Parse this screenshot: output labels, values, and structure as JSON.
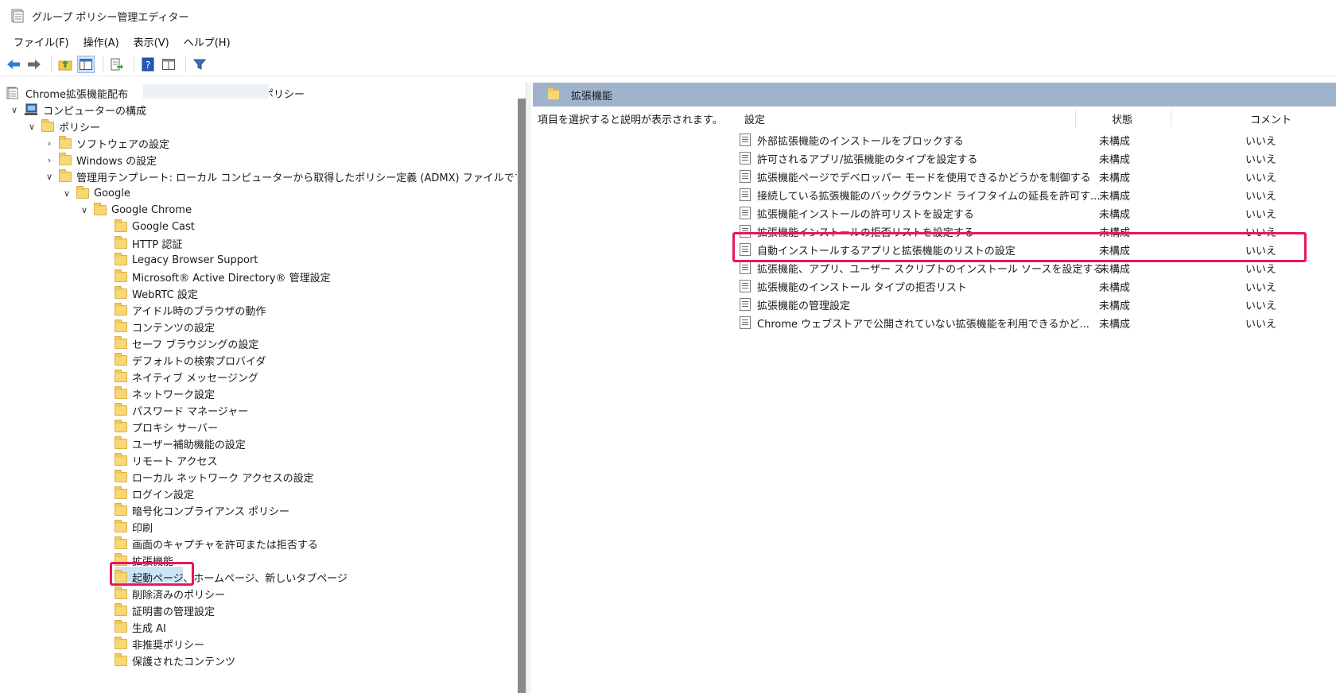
{
  "window": {
    "title": "グループ ポリシー管理エディター"
  },
  "menu": [
    "ファイル(F)",
    "操作(A)",
    "表示(V)",
    "ヘルプ(H)"
  ],
  "tree": {
    "root": {
      "label": "Chrome拡張機能配布",
      "suffix": "ポリシー"
    },
    "items": [
      {
        "label": "コンピューターの構成"
      },
      {
        "label": "ポリシー"
      },
      {
        "label": "ソフトウェアの設定"
      },
      {
        "label": "Windows の設定"
      },
      {
        "label": "管理用テンプレート: ローカル コンピューターから取得したポリシー定義 (ADMX) ファイルです。"
      },
      {
        "label": "Google"
      },
      {
        "label": "Google Chrome"
      },
      {
        "label": "Google Cast"
      },
      {
        "label": "HTTP 認証"
      },
      {
        "label": "Legacy Browser Support"
      },
      {
        "label": "Microsoft® Active Directory® 管理設定"
      },
      {
        "label": "WebRTC 設定"
      },
      {
        "label": "アイドル時のブラウザの動作"
      },
      {
        "label": "コンテンツの設定"
      },
      {
        "label": "セーフ ブラウジングの設定"
      },
      {
        "label": "デフォルトの検索プロバイダ"
      },
      {
        "label": "ネイティブ メッセージング"
      },
      {
        "label": "ネットワーク設定"
      },
      {
        "label": "パスワード マネージャー"
      },
      {
        "label": "プロキシ サーバー"
      },
      {
        "label": "ユーザー補助機能の設定"
      },
      {
        "label": "リモート アクセス"
      },
      {
        "label": "ローカル ネットワーク アクセスの設定"
      },
      {
        "label": "ログイン設定"
      },
      {
        "label": "暗号化コンプライアンス ポリシー"
      },
      {
        "label": "印刷"
      },
      {
        "label": "画面のキャプチャを許可または拒否する"
      },
      {
        "label": "拡張機能"
      },
      {
        "label": "起動ページ、ホームページ、新しいタブページ"
      },
      {
        "label": "削除済みのポリシー"
      },
      {
        "label": "証明書の管理設定"
      },
      {
        "label": "生成 AI"
      },
      {
        "label": "非推奨ポリシー"
      },
      {
        "label": "保護されたコンテンツ"
      }
    ]
  },
  "right": {
    "header": "拡張機能",
    "description": "項目を選択すると説明が表示されます。",
    "columns": {
      "setting": "設定",
      "state": "状態",
      "comment": "コメント"
    },
    "rows": [
      {
        "name": "外部拡張機能のインストールをブロックする",
        "state": "未構成",
        "comment": "いいえ"
      },
      {
        "name": "許可されるアプリ/拡張機能のタイプを設定する",
        "state": "未構成",
        "comment": "いいえ"
      },
      {
        "name": "拡張機能ページでデベロッパー モードを使用できるかどうかを制御する",
        "state": "未構成",
        "comment": "いいえ"
      },
      {
        "name": "接続している拡張機能のバックグラウンド ライフタイムの延長を許可す...",
        "state": "未構成",
        "comment": "いいえ"
      },
      {
        "name": "拡張機能インストールの許可リストを設定する",
        "state": "未構成",
        "comment": "いいえ"
      },
      {
        "name": "拡張機能インストールの拒否リストを設定する",
        "state": "未構成",
        "comment": "いいえ"
      },
      {
        "name": "自動インストールするアプリと拡張機能のリストの設定",
        "state": "未構成",
        "comment": "いいえ"
      },
      {
        "name": "拡張機能、アプリ、ユーザー スクリプトのインストール ソースを設定する",
        "state": "未構成",
        "comment": "いいえ"
      },
      {
        "name": "拡張機能のインストール タイプの拒否リスト",
        "state": "未構成",
        "comment": "いいえ"
      },
      {
        "name": "拡張機能の管理設定",
        "state": "未構成",
        "comment": "いいえ"
      },
      {
        "name": "Chrome ウェブストアで公開されていない拡張機能を利用できるかど...",
        "state": "未構成",
        "comment": "いいえ"
      }
    ]
  },
  "colors": {
    "highlight": "#e8175d",
    "pane_header": "#9fb4cc",
    "selection": "#cce4f7"
  }
}
